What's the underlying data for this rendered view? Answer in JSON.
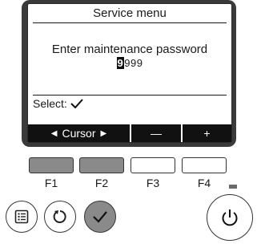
{
  "screen": {
    "title": "Service menu",
    "message": "Enter maintenance password",
    "password": {
      "cursor_digit": "9",
      "rest": "999"
    },
    "select_label": "Select:",
    "function_bar": {
      "cursor_label": "Cursor",
      "minus_label": "—",
      "plus_label": "+"
    }
  },
  "fkeys": [
    {
      "label": "F1",
      "highlighted": true
    },
    {
      "label": "F2",
      "highlighted": true
    },
    {
      "label": "F3",
      "highlighted": false
    },
    {
      "label": "F4",
      "highlighted": false
    }
  ],
  "buttons": [
    "menu-icon",
    "return-icon",
    "check-icon",
    "power-icon"
  ],
  "colors": {
    "highlight": "#8a8a8a",
    "bezel": "#3a3a3a",
    "bar": "#111111"
  }
}
